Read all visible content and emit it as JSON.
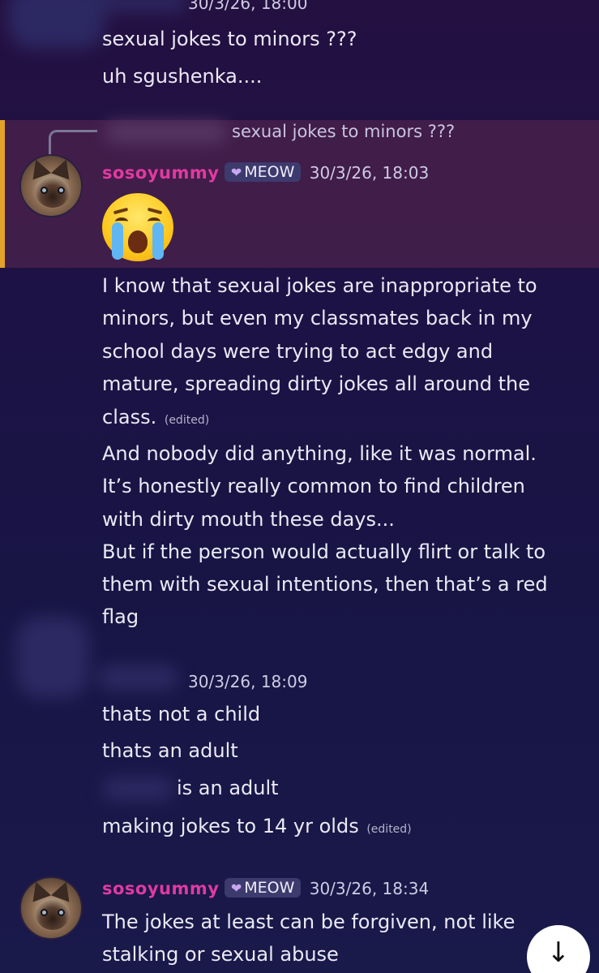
{
  "messages": {
    "m1": {
      "timestamp": "30/3/26, 18:00",
      "lines": [
        "sexual jokes to minors ???",
        "uh sgushenka...."
      ]
    },
    "reply_preview": "sexual jokes to minors ???",
    "m2": {
      "username": "sosoyummy",
      "badge": "MEOW",
      "timestamp": "30/3/26, 18:03",
      "emoji": "loudly-crying-face"
    },
    "m3": {
      "para1": [
        "I know that sexual jokes are inappropriate to",
        "minors, but even my classmates back in my",
        "school days were trying to act edgy and",
        "mature, spreading dirty jokes all around the",
        "class."
      ],
      "edited_label": "(edited)",
      "para2": [
        "And nobody did anything, like it was normal.",
        "It’s honestly really common to find children",
        "with dirty mouth these days...",
        "But if the person would actually flirt or talk to",
        "them with sexual intentions, then that’s a red",
        "flag"
      ]
    },
    "m4": {
      "timestamp": "30/3/26, 18:09",
      "lines": [
        "thats not a child",
        "thats an adult",
        "is an adult",
        "making jokes to 14 yr olds"
      ],
      "edited_label": "(edited)"
    },
    "m5": {
      "username": "sosoyummy",
      "badge": "MEOW",
      "timestamp": "30/3/26, 18:34",
      "lines": [
        "The jokes at least can be forgiven, not like",
        "stalking or sexual abuse"
      ]
    }
  },
  "scroll_button": {
    "icon": "arrow-down-icon",
    "glyph": "↓"
  },
  "colors": {
    "username": "#e03aa0",
    "highlight_bar": "#e3a32b",
    "background": "#1d1245"
  }
}
